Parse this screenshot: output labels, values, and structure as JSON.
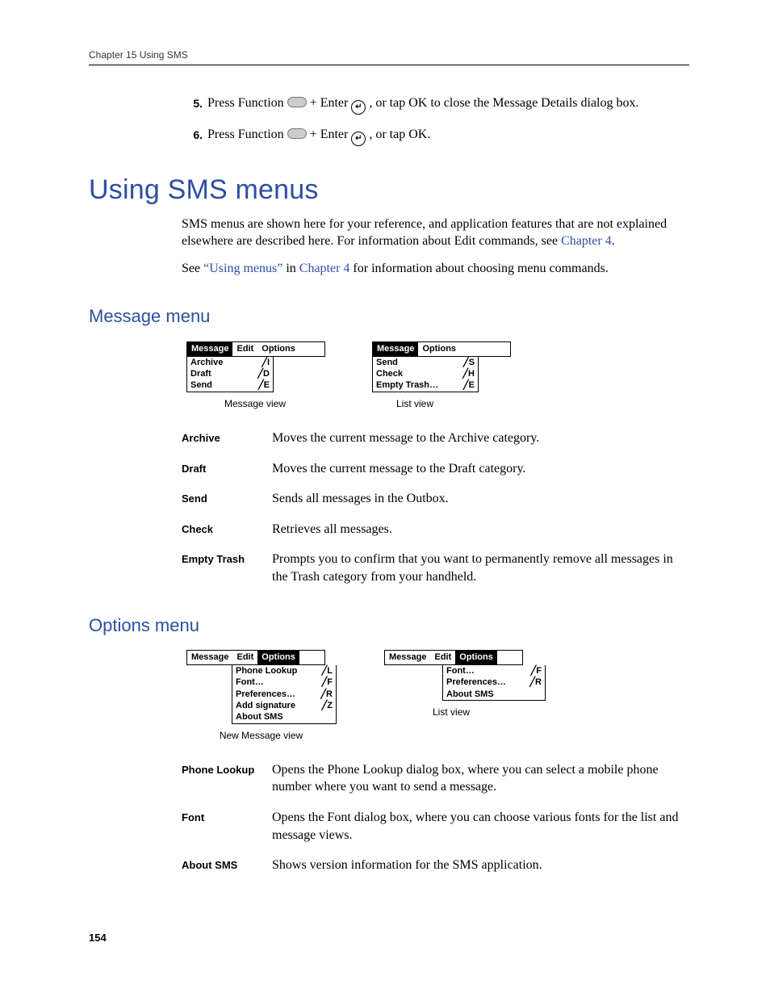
{
  "running_head": "Chapter 15   Using SMS",
  "step5": {
    "num": "5.",
    "pre": "Press Function ",
    "mid1": " + Enter ",
    "post": ", or tap OK to close the Message Details dialog box."
  },
  "step6": {
    "num": "6.",
    "pre": "Press Function ",
    "mid1": " + Enter ",
    "post": ", or tap OK."
  },
  "h1": "Using SMS menus",
  "intro1a": "SMS menus are shown here for your reference, and application features that are not explained elsewhere are described here. For information about Edit commands, see ",
  "intro1_link": "Chapter 4",
  "intro1b": ".",
  "intro2a": "See ",
  "intro2_link1": "“Using menus”",
  "intro2b": " in ",
  "intro2_link2": "Chapter 4",
  "intro2c": " for information about choosing menu commands.",
  "h2a": "Message menu",
  "palm_msg_view": {
    "menubar": [
      "Message",
      "Edit",
      "Options"
    ],
    "selected": 0,
    "items": [
      {
        "label": "Archive",
        "short": "I"
      },
      {
        "label": "Draft",
        "short": "D"
      },
      {
        "label": "Send",
        "short": "E"
      }
    ],
    "caption": "Message view"
  },
  "palm_list_view": {
    "menubar": [
      "Message",
      "Options"
    ],
    "selected": 0,
    "items": [
      {
        "label": "Send",
        "short": "S"
      },
      {
        "label": "Check",
        "short": "H"
      },
      {
        "label": "Empty Trash…",
        "short": "E"
      }
    ],
    "caption": "List view"
  },
  "msg_defs": [
    {
      "term": "Archive",
      "desc": "Moves the current message to the Archive category."
    },
    {
      "term": "Draft",
      "desc": "Moves the current message to the Draft category."
    },
    {
      "term": "Send",
      "desc": "Sends all messages in the Outbox."
    },
    {
      "term": "Check",
      "desc": "Retrieves all messages."
    },
    {
      "term": "Empty Trash",
      "desc": "Prompts you to confirm that you want to permanently remove all messages in the Trash category from your handheld."
    }
  ],
  "h2b": "Options menu",
  "palm_opt_new": {
    "menubar": [
      "Message",
      "Edit",
      "Options"
    ],
    "selected": 2,
    "items": [
      {
        "label": "Phone Lookup",
        "short": "L"
      },
      {
        "label": "Font…",
        "short": "F"
      },
      {
        "label": "Preferences…",
        "short": "R"
      },
      {
        "label": "Add signature",
        "short": "Z"
      },
      {
        "label": "About SMS",
        "short": ""
      }
    ],
    "caption": "New Message view"
  },
  "palm_opt_list": {
    "menubar": [
      "Message",
      "Edit",
      "Options"
    ],
    "selected": 2,
    "items": [
      {
        "label": "Font…",
        "short": "F"
      },
      {
        "label": "Preferences…",
        "short": "R"
      },
      {
        "label": "About SMS",
        "short": ""
      }
    ],
    "caption": "List view"
  },
  "opt_defs": [
    {
      "term": "Phone Lookup",
      "desc": "Opens the Phone Lookup dialog box, where you can select a mobile phone number where you want to send a message."
    },
    {
      "term": "Font",
      "desc": "Opens the Font dialog box, where you can choose various fonts for the list and message views."
    },
    {
      "term": "About SMS",
      "desc": "Shows version information for the SMS application."
    }
  ],
  "page_num": "154"
}
